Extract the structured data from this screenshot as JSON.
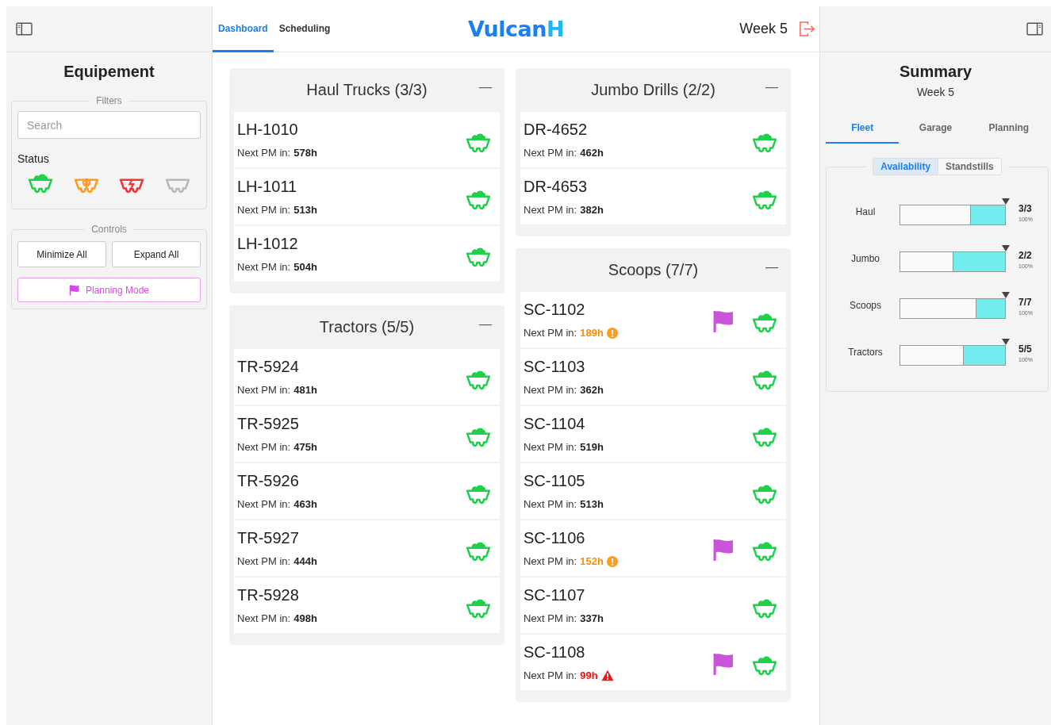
{
  "nav_tabs": [
    {
      "label": "Dashboard",
      "selected": true
    },
    {
      "label": "Scheduling",
      "selected": false
    }
  ],
  "logo": {
    "main": "Vulcan",
    "accent": "H"
  },
  "week": "Week 5",
  "sidebar": {
    "title": "Equipement",
    "filters": {
      "legend": "Filters",
      "search": {
        "placeholder": "Search"
      },
      "status_label": "Status",
      "statuses": [
        {
          "kind": "available"
        },
        {
          "kind": "maintenance"
        },
        {
          "kind": "breakdown"
        },
        {
          "kind": "inactive"
        }
      ]
    },
    "controls": {
      "legend": "Controls",
      "buttons": [
        "Minimize All",
        "Expand All"
      ],
      "planning_mode": "Planning Mode"
    }
  },
  "columns": [
    [
      {
        "title": "Haul Trucks (3/3)",
        "collapse": "—",
        "items": [
          {
            "id": "LH-1010",
            "pm_label": "Next PM in:",
            "pm_hours": "578h",
            "planned": false
          },
          {
            "id": "LH-1011",
            "pm_label": "Next PM in:",
            "pm_hours": "513h",
            "planned": false
          },
          {
            "id": "LH-1012",
            "pm_label": "Next PM in:",
            "pm_hours": "504h",
            "planned": false
          }
        ]
      },
      {
        "title": "Tractors (5/5)",
        "collapse": "—",
        "items": [
          {
            "id": "TR-5924",
            "pm_label": "Next PM in:",
            "pm_hours": "481h",
            "planned": false
          },
          {
            "id": "TR-5925",
            "pm_label": "Next PM in:",
            "pm_hours": "475h",
            "planned": false
          },
          {
            "id": "TR-5926",
            "pm_label": "Next PM in:",
            "pm_hours": "463h",
            "planned": false
          },
          {
            "id": "TR-5927",
            "pm_label": "Next PM in:",
            "pm_hours": "444h",
            "planned": false
          },
          {
            "id": "TR-5928",
            "pm_label": "Next PM in:",
            "pm_hours": "498h",
            "planned": false
          }
        ]
      }
    ],
    [
      {
        "title": "Jumbo Drills (2/2)",
        "collapse": "—",
        "items": [
          {
            "id": "DR-4652",
            "pm_label": "Next PM in:",
            "pm_hours": "462h",
            "planned": false
          },
          {
            "id": "DR-4653",
            "pm_label": "Next PM in:",
            "pm_hours": "382h",
            "planned": false
          }
        ]
      },
      {
        "title": "Scoops (7/7)",
        "collapse": "—",
        "items": [
          {
            "id": "SC-1102",
            "pm_label": "Next PM in:",
            "pm_hours": "189h",
            "kind": "warning",
            "planned": true
          },
          {
            "id": "SC-1103",
            "pm_label": "Next PM in:",
            "pm_hours": "362h",
            "planned": false
          },
          {
            "id": "SC-1104",
            "pm_label": "Next PM in:",
            "pm_hours": "519h",
            "planned": false
          },
          {
            "id": "SC-1105",
            "pm_label": "Next PM in:",
            "pm_hours": "513h",
            "planned": false
          },
          {
            "id": "SC-1106",
            "pm_label": "Next PM in:",
            "pm_hours": "152h",
            "kind": "warning",
            "planned": true
          },
          {
            "id": "SC-1107",
            "pm_label": "Next PM in:",
            "pm_hours": "337h",
            "planned": false
          },
          {
            "id": "SC-1108",
            "pm_label": "Next PM in:",
            "pm_hours": "99h",
            "kind": "critical",
            "planned": true
          }
        ]
      }
    ]
  ],
  "summary": {
    "title": "Summary",
    "subtitle": "Week 5",
    "tabs": [
      {
        "label": "Fleet",
        "selected": true
      },
      {
        "label": "Garage",
        "selected": false
      },
      {
        "label": "Planning",
        "selected": false
      }
    ],
    "subtabs": [
      {
        "label": "Availability",
        "selected": true
      },
      {
        "label": "Standstills",
        "selected": false
      }
    ],
    "rows": [
      {
        "label": "Haul",
        "count": "3/3",
        "percent": "100%",
        "level": 0.33
      },
      {
        "label": "Jumbo",
        "count": "2/2",
        "percent": "100%",
        "level": 0.5
      },
      {
        "label": "Scoops",
        "count": "7/7",
        "percent": "100%",
        "level": 0.28
      },
      {
        "label": "Tractors",
        "count": "5/5",
        "percent": "100%",
        "level": 0.4
      }
    ]
  }
}
